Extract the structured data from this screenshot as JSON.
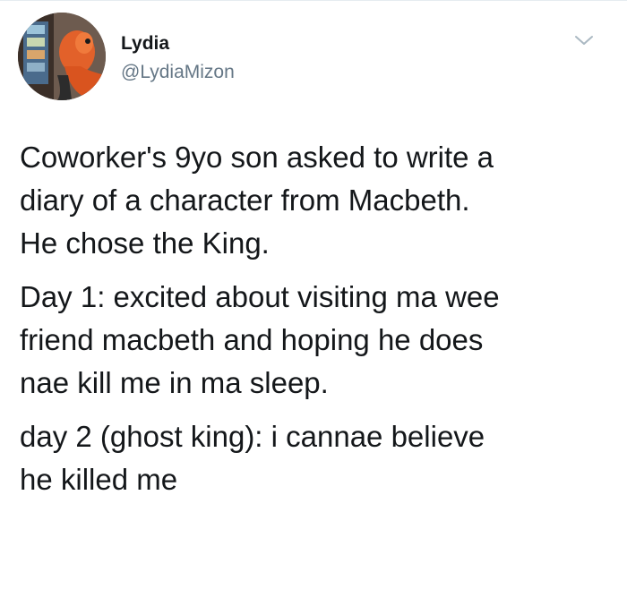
{
  "author": {
    "name": "Lydia",
    "handle": "@LydiaMizon",
    "avatar_icon": "profile-avatar-photo"
  },
  "menu": {
    "icon": "chevron-down-icon",
    "color": "#aab8c2"
  },
  "tweet": {
    "paragraphs": [
      "Coworker's 9yo son asked to write a\ndiary of a character from Macbeth.\nHe chose the King.",
      "Day 1: excited about visiting ma wee\nfriend macbeth and hoping he does\nnae kill me in ma sleep.",
      "day 2 (ghost king):  i cannae believe\nhe killed me"
    ]
  },
  "colors": {
    "text": "#14171a",
    "secondary": "#657786",
    "background": "#ffffff"
  }
}
